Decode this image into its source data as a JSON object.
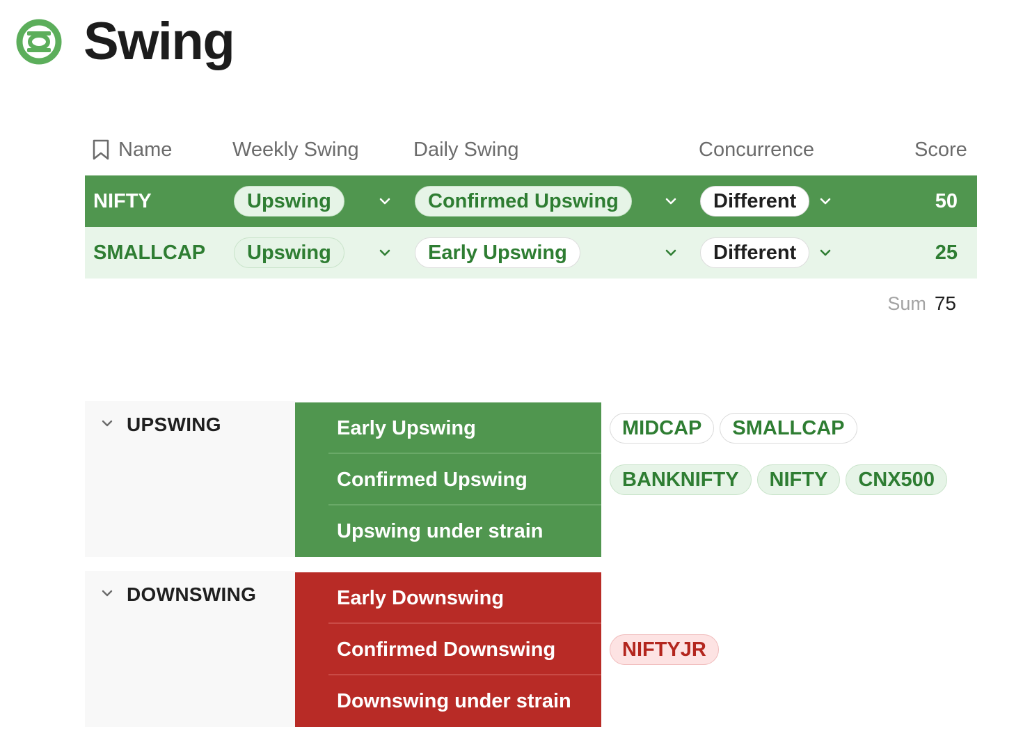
{
  "page": {
    "title": "Swing",
    "icon": "lantern-ring-icon",
    "accent": "#5cae5b"
  },
  "table": {
    "columns": {
      "name": "Name",
      "weekly": "Weekly Swing",
      "daily": "Daily Swing",
      "concurrence": "Concurrence",
      "score": "Score"
    },
    "rows": [
      {
        "name": "NIFTY",
        "weekly": "Upswing",
        "daily": "Confirmed Upswing",
        "concurrence": "Different",
        "score": "50",
        "row_color": "#50964f"
      },
      {
        "name": "SMALLCAP",
        "weekly": "Upswing",
        "daily": "Early Upswing",
        "concurrence": "Different",
        "score": "25",
        "row_color": "#e8f5e9"
      }
    ],
    "sum_label": "Sum",
    "sum_value": "75"
  },
  "groups": {
    "upswing": {
      "title": "UPSWING",
      "color": "#50964f",
      "stages": [
        {
          "label": "Early Upswing",
          "tags": [
            "MIDCAP",
            "SMALLCAP"
          ]
        },
        {
          "label": "Confirmed Upswing",
          "tags": [
            "BANKNIFTY",
            "NIFTY",
            "CNX500"
          ]
        },
        {
          "label": "Upswing under strain",
          "tags": []
        }
      ]
    },
    "downswing": {
      "title": "DOWNSWING",
      "color": "#b82b26",
      "stages": [
        {
          "label": "Early Downswing",
          "tags": []
        },
        {
          "label": "Confirmed Downswing",
          "tags": [
            "NIFTYJR"
          ]
        },
        {
          "label": "Downswing under strain",
          "tags": []
        }
      ]
    }
  }
}
